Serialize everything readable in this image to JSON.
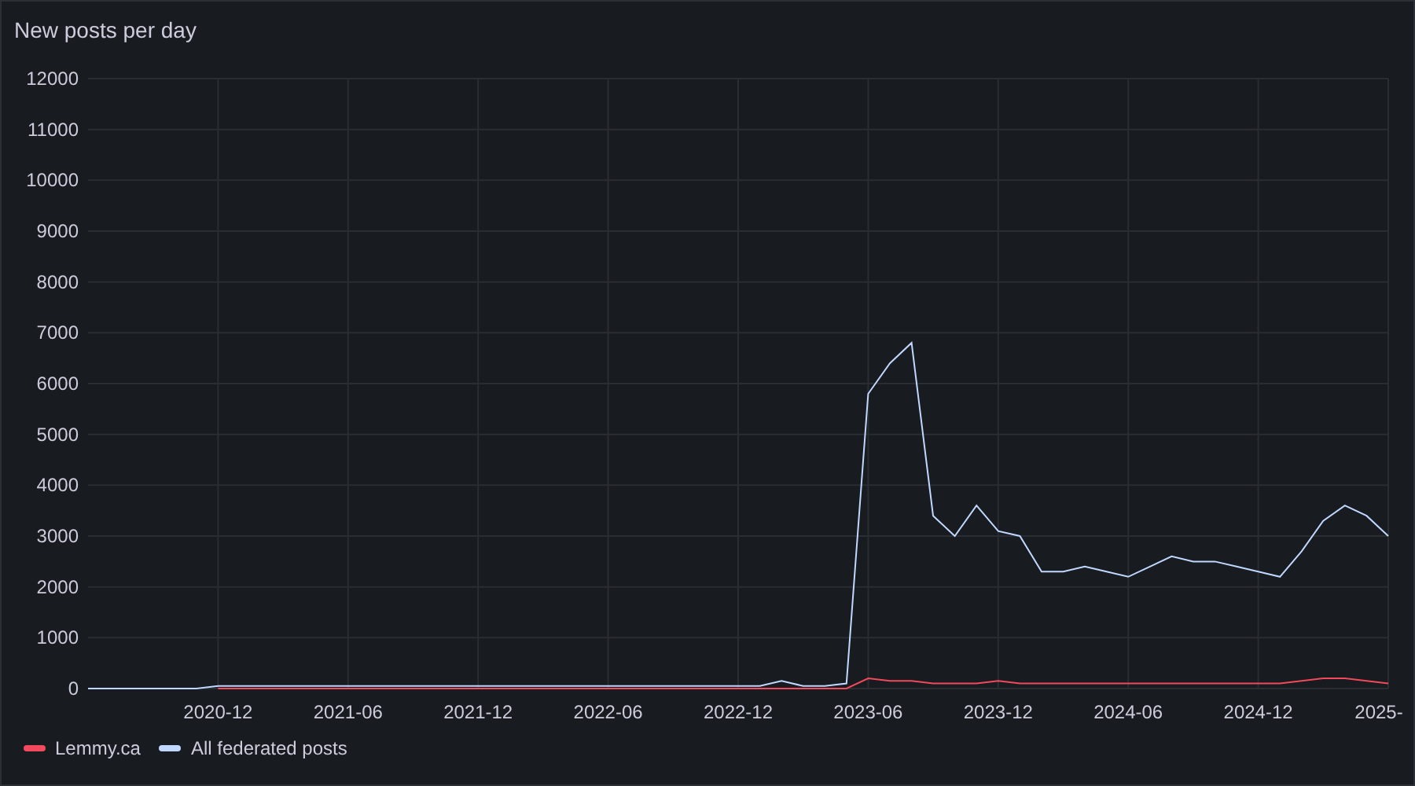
{
  "panel": {
    "title": "New posts per day",
    "chart_data": {
      "type": "line",
      "x": [
        "2020-06",
        "2020-07",
        "2020-08",
        "2020-09",
        "2020-10",
        "2020-11",
        "2020-12",
        "2021-01",
        "2021-02",
        "2021-03",
        "2021-04",
        "2021-05",
        "2021-06",
        "2021-07",
        "2021-08",
        "2021-09",
        "2021-10",
        "2021-11",
        "2021-12",
        "2022-01",
        "2022-02",
        "2022-03",
        "2022-04",
        "2022-05",
        "2022-06",
        "2022-07",
        "2022-08",
        "2022-09",
        "2022-10",
        "2022-11",
        "2022-12",
        "2023-01",
        "2023-02",
        "2023-03",
        "2023-04",
        "2023-05",
        "2023-06",
        "2023-07",
        "2023-08",
        "2023-09",
        "2023-10",
        "2023-11",
        "2023-12",
        "2024-01",
        "2024-02",
        "2024-03",
        "2024-04",
        "2024-05",
        "2024-06",
        "2024-07",
        "2024-08",
        "2024-09",
        "2024-10",
        "2024-11",
        "2024-12",
        "2025-01",
        "2025-02",
        "2025-03",
        "2025-04",
        "2025-05",
        "2025-06"
      ],
      "series": [
        {
          "name": "Lemmy.ca",
          "color": "#f2495c",
          "values": [
            null,
            null,
            null,
            null,
            null,
            null,
            0,
            0,
            0,
            0,
            0,
            0,
            0,
            0,
            0,
            0,
            0,
            0,
            0,
            0,
            0,
            0,
            0,
            0,
            0,
            0,
            0,
            0,
            0,
            0,
            0,
            0,
            0,
            0,
            0,
            0,
            200,
            150,
            150,
            100,
            100,
            100,
            150,
            100,
            100,
            100,
            100,
            100,
            100,
            100,
            100,
            100,
            100,
            100,
            100,
            100,
            150,
            200,
            200,
            150,
            100
          ]
        },
        {
          "name": "All federated posts",
          "color": "#c0d8ff",
          "values": [
            0,
            0,
            0,
            0,
            0,
            0,
            50,
            50,
            50,
            50,
            50,
            50,
            50,
            50,
            50,
            50,
            50,
            50,
            50,
            50,
            50,
            50,
            50,
            50,
            50,
            50,
            50,
            50,
            50,
            50,
            50,
            50,
            150,
            50,
            50,
            100,
            5800,
            6400,
            6800,
            3400,
            3000,
            3600,
            3100,
            3000,
            2300,
            2300,
            2400,
            2300,
            2200,
            2400,
            2600,
            2500,
            2500,
            2400,
            2300,
            2200,
            2700,
            3300,
            3600,
            3400,
            3000
          ]
        }
      ],
      "xlim": [
        "2020-06",
        "2025-06"
      ],
      "ylim": [
        0,
        12000
      ],
      "grid": true,
      "yticks": [
        0,
        1000,
        2000,
        3000,
        4000,
        5000,
        6000,
        7000,
        8000,
        9000,
        10000,
        11000,
        12000
      ],
      "xticks": [
        "2020-12",
        "2021-06",
        "2021-12",
        "2022-06",
        "2022-12",
        "2023-06",
        "2023-12",
        "2024-06",
        "2024-12",
        {
          "value": "2025-06",
          "label": "2025-"
        }
      ]
    }
  }
}
